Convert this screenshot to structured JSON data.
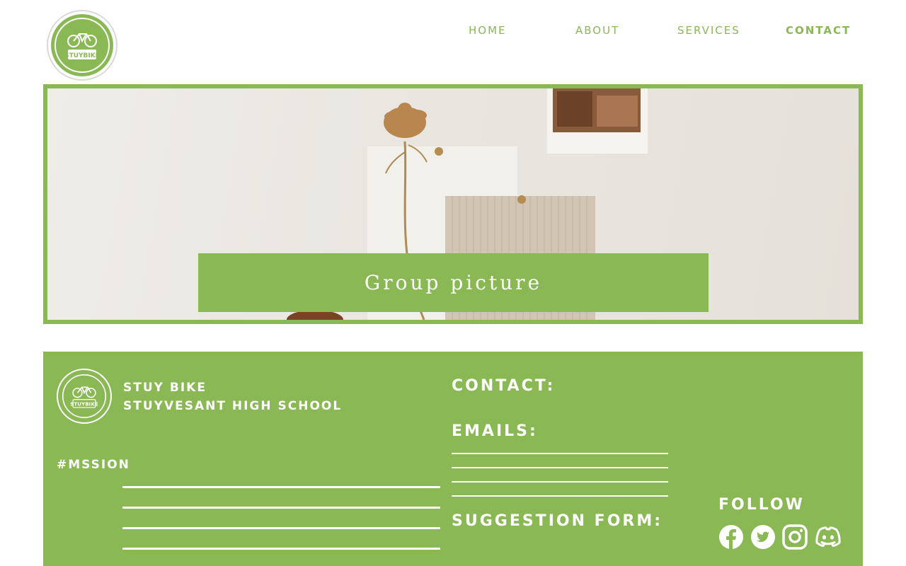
{
  "brand": {
    "logo_text": "STUYBIKE"
  },
  "nav": {
    "items": [
      {
        "label": "HOME"
      },
      {
        "label": "ABOUT"
      },
      {
        "label": "SERVICES"
      },
      {
        "label": "CONTACT",
        "active": true
      }
    ]
  },
  "hero": {
    "caption": "Group picture"
  },
  "footer": {
    "org_name": "STUY BIKE",
    "school_name": "STUYVESANT HIGH SCHOOL",
    "mission_label": "#MSSION",
    "contact_heading": "CONTACT:",
    "emails_heading": "EMAILS:",
    "suggestion_heading": "SUGGESTION FORM:",
    "follow_label": "FOLLOW",
    "social_icons": [
      "facebook-icon",
      "twitter-icon",
      "instagram-icon",
      "discord-icon"
    ]
  },
  "colors": {
    "accent": "#8ab855",
    "text_on_accent": "#ffffff",
    "background": "#ffffff"
  }
}
